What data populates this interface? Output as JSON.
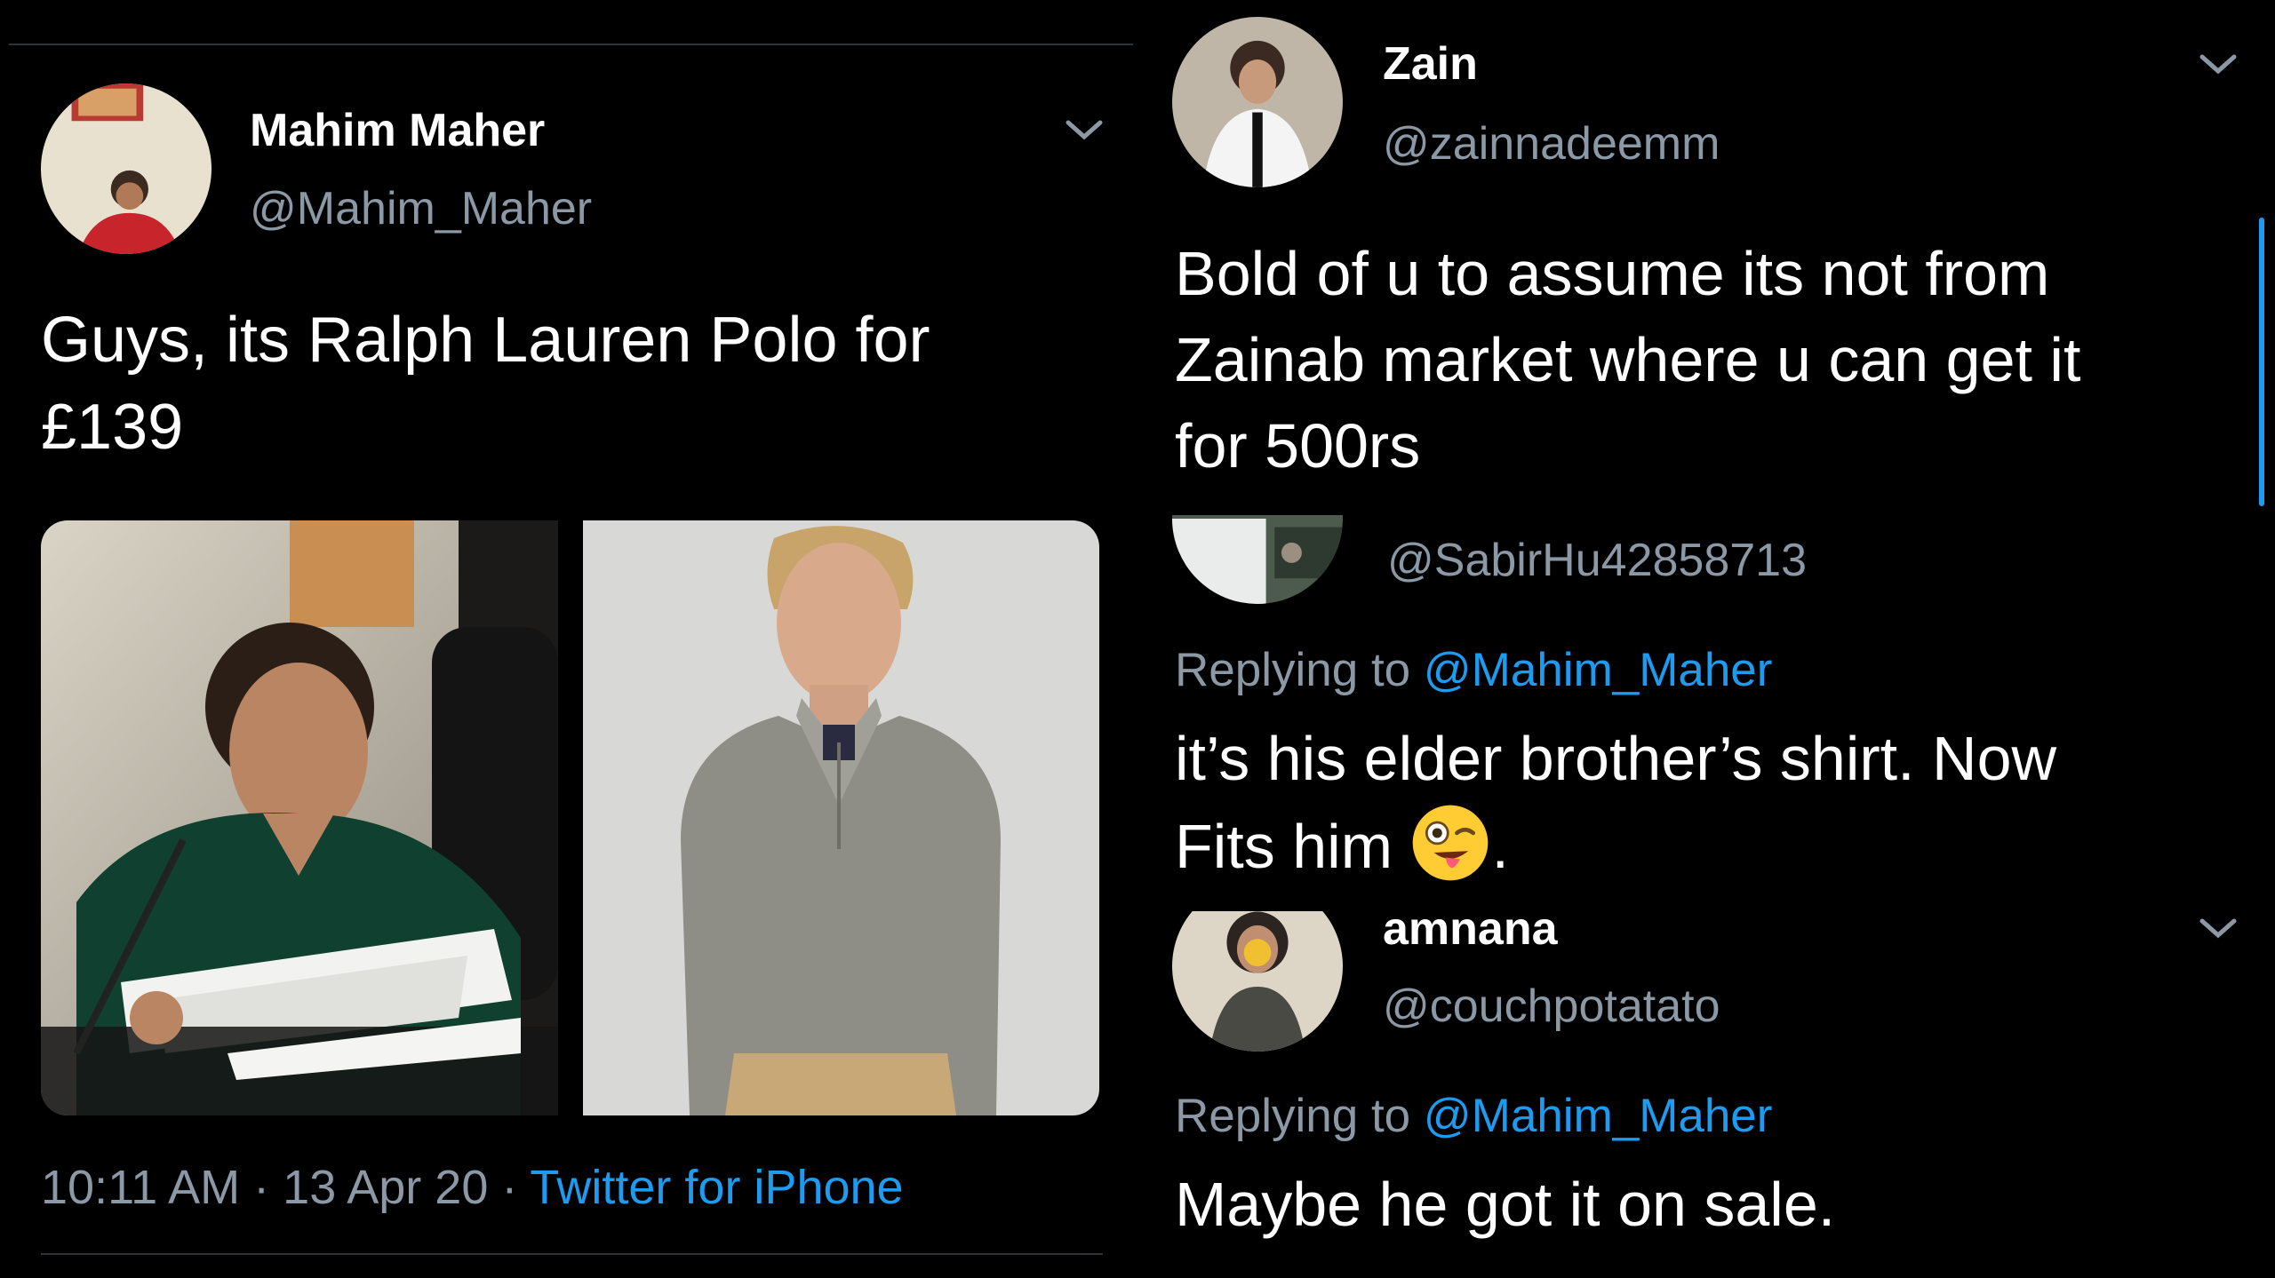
{
  "main_tweet": {
    "author_name": "Mahim Maher",
    "author_handle": "@Mahim_Maher",
    "text_line1": "Guys, its Ralph Lauren Polo for",
    "text_line2": "£139",
    "time": "10:11 AM",
    "date": "13 Apr 20",
    "separator": "·",
    "source": "Twitter for iPhone",
    "avatar_icon": "profile-avatar",
    "menu_icon": "chevron-down-icon"
  },
  "replies": [
    {
      "author_name": "Zain",
      "author_handle": "@zainnadeemm",
      "text_lines": [
        "Bold of u to assume its not from",
        "Zainab market where u can get it",
        "for 500rs"
      ]
    },
    {
      "author_handle": "@SabirHu42858713",
      "replying_prefix": "Replying to",
      "replying_to": "@Mahim_Maher",
      "text_line1": "it’s his elder brother’s shirt. Now",
      "text_line2_before": "Fits him",
      "text_line2_after": ".",
      "emoji_icon": "winking-tongue-face-emoji"
    },
    {
      "author_name": "amnana",
      "author_handle": "@couchpotatato",
      "replying_prefix": "Replying to",
      "replying_to": "@Mahim_Maher",
      "text_lines": [
        "Maybe he got it on sale."
      ]
    }
  ],
  "colors": {
    "background": "#000000",
    "text": "#ffffff",
    "secondary": "#8b98a5",
    "link": "#1d9bf0",
    "divider": "#2f3336"
  }
}
